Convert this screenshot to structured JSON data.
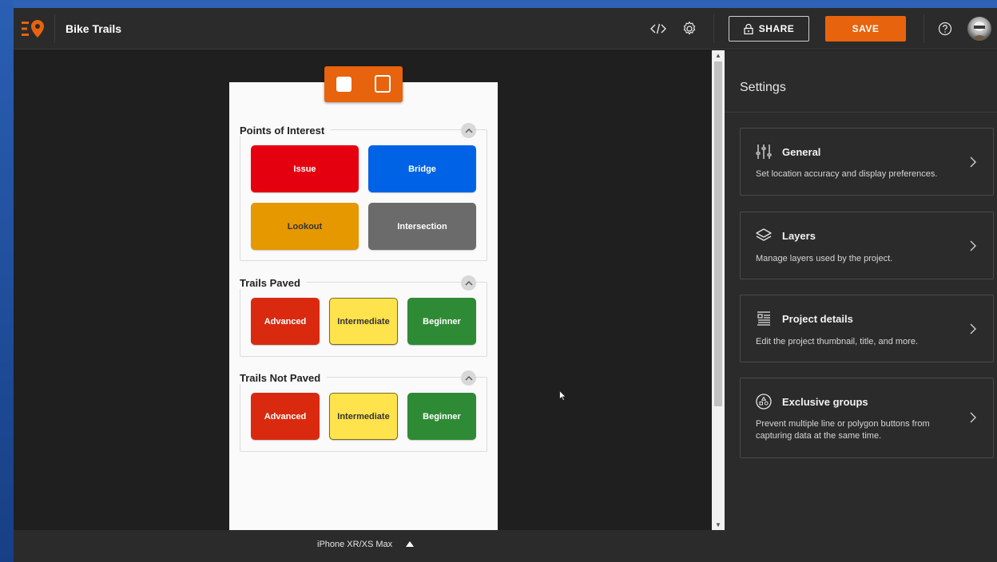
{
  "app": {
    "title": "Bike Trails"
  },
  "toolbar": {
    "share_label": "SHARE",
    "save_label": "SAVE"
  },
  "colors": {
    "accent": "#e8630d",
    "issue": "#e5000f",
    "bridge": "#0063e6",
    "lookout": "#e59800",
    "intersection": "#6b6b6b",
    "advanced": "#d92a10",
    "intermediate": "#ffe34d",
    "beginner": "#2f8a36"
  },
  "preview": {
    "groups": [
      {
        "title": "Points of Interest",
        "tiles": [
          "Issue",
          "Bridge",
          "Lookout",
          "Intersection"
        ]
      },
      {
        "title": "Trails Paved",
        "tiles": [
          "Advanced",
          "Intermediate",
          "Beginner"
        ]
      },
      {
        "title": "Trails Not Paved",
        "tiles": [
          "Advanced",
          "Intermediate",
          "Beginner"
        ]
      }
    ],
    "device": "iPhone XR/XS Max"
  },
  "settings": {
    "title": "Settings",
    "cards": [
      {
        "title": "General",
        "desc": "Set location accuracy and display preferences.",
        "icon": "sliders-icon"
      },
      {
        "title": "Layers",
        "desc": "Manage layers used by the project.",
        "icon": "layers-icon"
      },
      {
        "title": "Project details",
        "desc": "Edit the project thumbnail, title, and more.",
        "icon": "details-icon"
      },
      {
        "title": "Exclusive groups",
        "desc": "Prevent multiple line or polygon buttons from capturing data at the same time.",
        "icon": "shapes-icon"
      }
    ]
  }
}
